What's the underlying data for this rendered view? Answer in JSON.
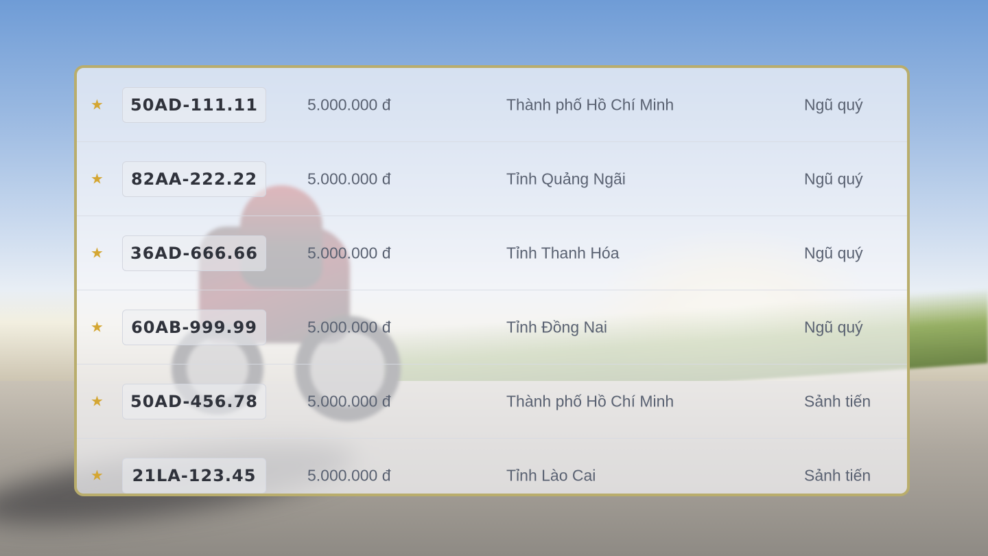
{
  "rows": [
    {
      "plate": "50AD-111.11",
      "price": "5.000.000 đ",
      "province": "Thành phố Hồ Chí Minh",
      "type": "Ngũ quý"
    },
    {
      "plate": "82AA-222.22",
      "price": "5.000.000 đ",
      "province": "Tỉnh Quảng Ngãi",
      "type": "Ngũ quý"
    },
    {
      "plate": "36AD-666.66",
      "price": "5.000.000 đ",
      "province": "Tỉnh Thanh Hóa",
      "type": "Ngũ quý"
    },
    {
      "plate": "60AB-999.99",
      "price": "5.000.000 đ",
      "province": "Tỉnh Đồng Nai",
      "type": "Ngũ quý"
    },
    {
      "plate": "50AD-456.78",
      "price": "5.000.000 đ",
      "province": "Thành phố Hồ Chí Minh",
      "type": "Sảnh tiến"
    },
    {
      "plate": "21LA-123.45",
      "price": "5.000.000 đ",
      "province": "Tỉnh Lào Cai",
      "type": "Sảnh tiến"
    }
  ],
  "icons": {
    "row_marker": "star-icon"
  },
  "colors": {
    "accent_border": "#b9ad6c",
    "star": "#d4a632"
  }
}
